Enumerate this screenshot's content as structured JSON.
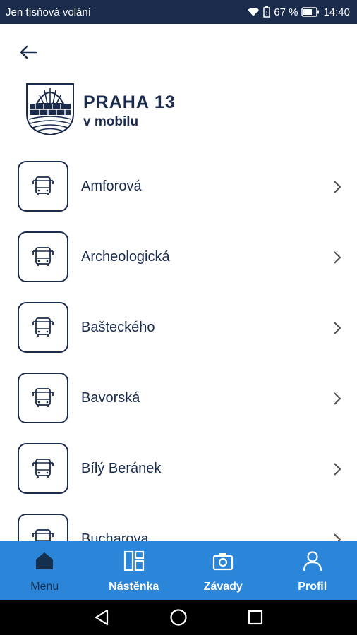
{
  "status_bar": {
    "carrier": "Jen tísňová volání",
    "battery_percent": "67 %",
    "time": "14:40"
  },
  "header": {
    "brand_title": "PRAHA 13",
    "brand_subtitle": "v mobilu"
  },
  "list": {
    "items": [
      {
        "label": "Amforová",
        "icon": "bus-icon"
      },
      {
        "label": "Archeologická",
        "icon": "bus-icon"
      },
      {
        "label": "Bašteckého",
        "icon": "bus-icon"
      },
      {
        "label": "Bavorská",
        "icon": "bus-icon"
      },
      {
        "label": "Bílý Beránek",
        "icon": "bus-icon"
      },
      {
        "label": "Bucharova",
        "icon": "bus-icon"
      }
    ]
  },
  "bottom_nav": {
    "tabs": [
      {
        "label": "Menu",
        "icon": "home-icon",
        "active": true
      },
      {
        "label": "Nástěnka",
        "icon": "dashboard-icon",
        "active": false
      },
      {
        "label": "Závady",
        "icon": "camera-icon",
        "active": false
      },
      {
        "label": "Profil",
        "icon": "user-icon",
        "active": false
      }
    ]
  },
  "colors": {
    "navy": "#1a2b4c",
    "nav_blue": "#2b86d9",
    "active_tab": "#15304f"
  }
}
